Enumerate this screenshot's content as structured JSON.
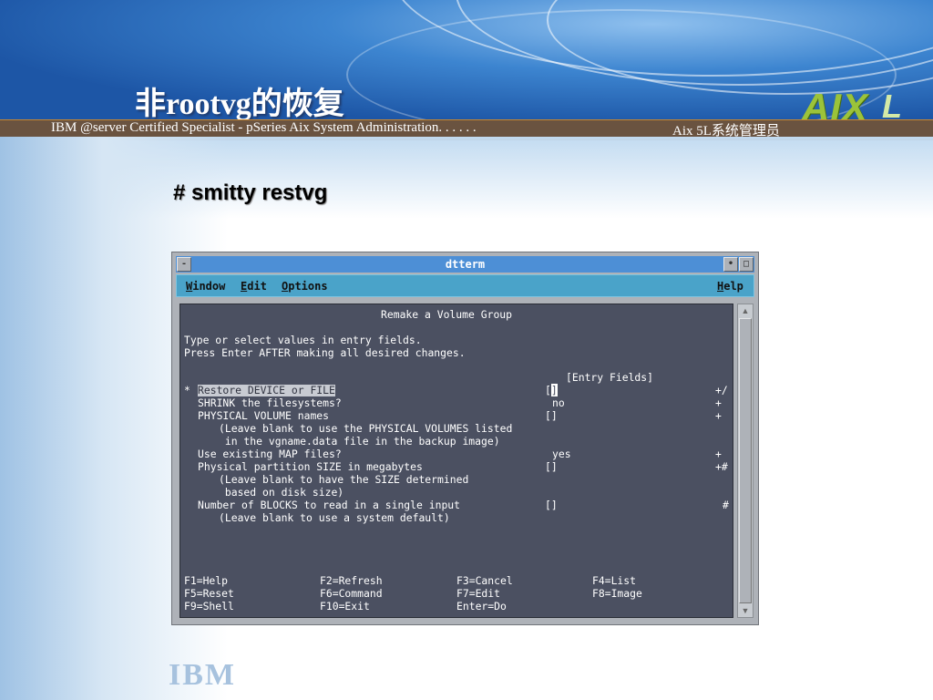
{
  "slide": {
    "title": "非rootvg的恢复",
    "stripe_left": "IBM @server Certified Specialist - pSeries Aix System Administration. . . . . .",
    "stripe_right": "Aix 5L系统管理员",
    "logo_text": "AIX",
    "logo_suffix": "L",
    "watermark": "IBM",
    "command": "# smitty restvg"
  },
  "window": {
    "title": "dtterm",
    "btn_minimize": "-",
    "btn_menu": "•",
    "btn_maximize": "□",
    "menu": {
      "window": "Window",
      "edit": "Edit",
      "options": "Options",
      "help": "Help"
    },
    "menu_mnemonics": {
      "window": "W",
      "edit": "E",
      "options": "O",
      "help": "H"
    }
  },
  "screen": {
    "header": "Remake a Volume Group",
    "intro1": "Type or select values in entry fields.",
    "intro2": "Press Enter AFTER making all desired changes.",
    "entry_header": "[Entry Fields]",
    "fields": [
      {
        "star": "*",
        "label": "Restore DEVICE or FILE",
        "value": "[",
        "value_cursor": "]",
        "flag": "+/"
      },
      {
        "label": "SHRINK the filesystems?",
        "value": "no",
        "flag": "+"
      },
      {
        "label": "PHYSICAL VOLUME names",
        "value": "[]",
        "flag": "+"
      },
      {
        "note": "(Leave blank to use the PHYSICAL VOLUMES listed"
      },
      {
        "note": " in the vgname.data file in the backup image)"
      },
      {
        "label": "Use existing MAP files?",
        "value": "yes",
        "flag": "+"
      },
      {
        "label": "Physical partition SIZE in megabytes",
        "value": "[]",
        "flag": "+#"
      },
      {
        "note": "(Leave blank to have the SIZE determined"
      },
      {
        "note": " based on disk size)"
      },
      {
        "label": "Number of BLOCKS to read in a single input",
        "value": "[]",
        "flag": "#"
      },
      {
        "note": "(Leave blank to use a system default)"
      }
    ],
    "fkeys": [
      [
        "F1=Help",
        "F2=Refresh",
        "F3=Cancel",
        "F4=List"
      ],
      [
        "F5=Reset",
        "F6=Command",
        "F7=Edit",
        "F8=Image"
      ],
      [
        "F9=Shell",
        "F10=Exit",
        "Enter=Do",
        ""
      ]
    ]
  }
}
